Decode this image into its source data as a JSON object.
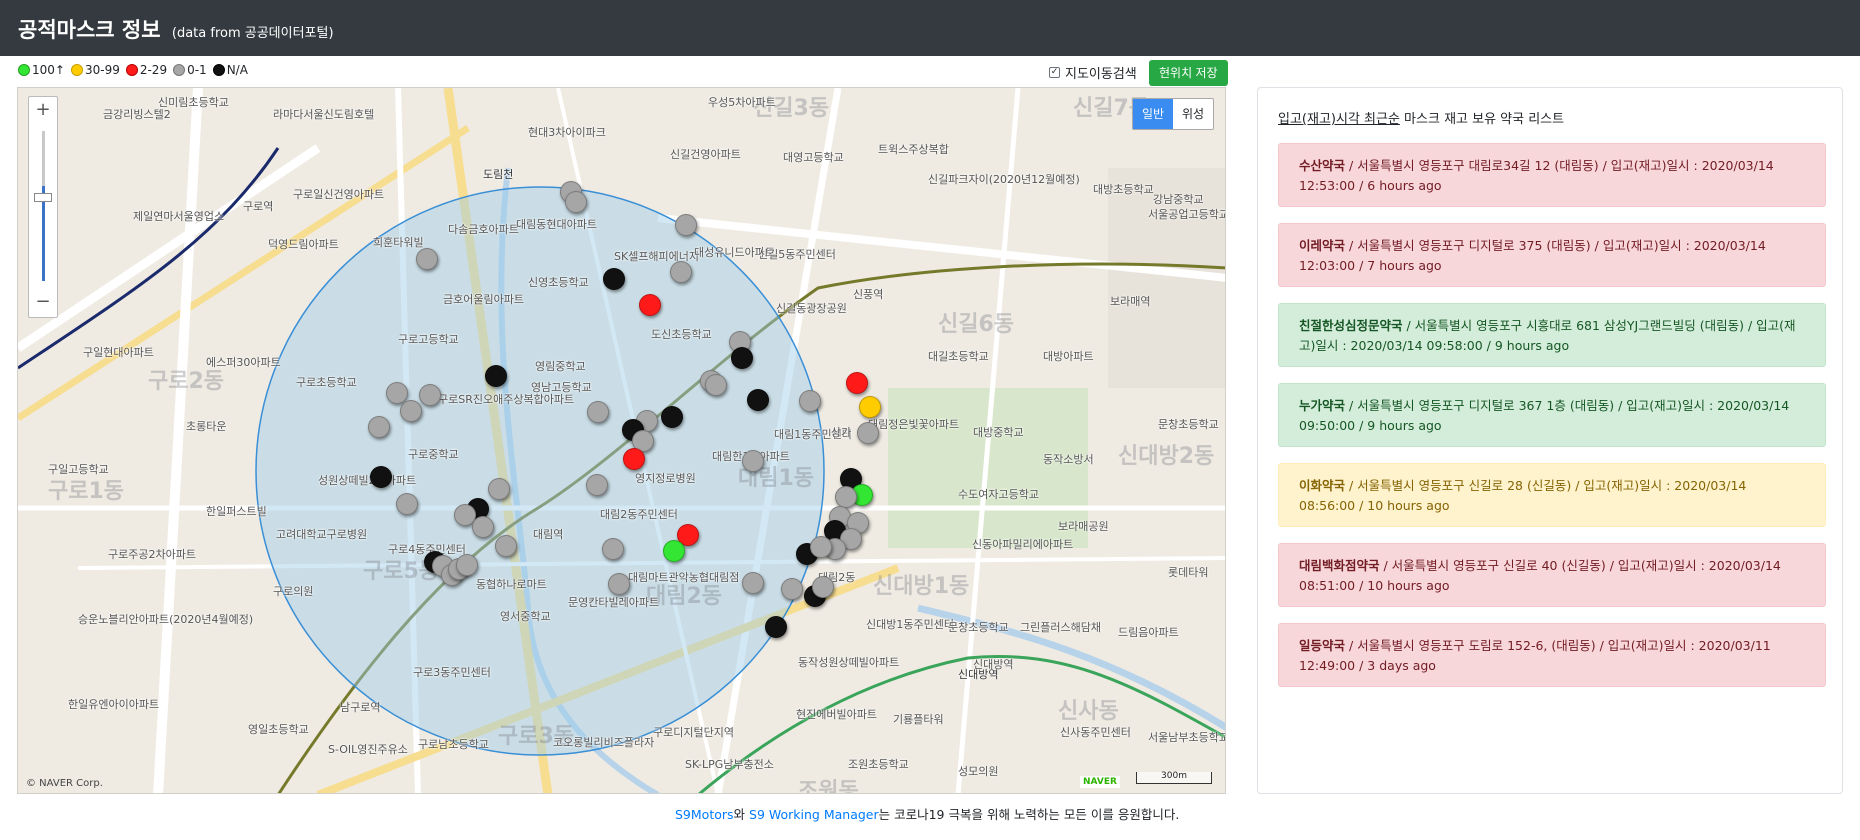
{
  "header": {
    "title": "공적마스크 정보",
    "subtitle": "(data from 공공데이터포털)"
  },
  "legend": [
    {
      "label": "100↑",
      "color": "#33e633"
    },
    {
      "label": "30-99",
      "color": "#ffcc00"
    },
    {
      "label": "2-29",
      "color": "#ff1a1a"
    },
    {
      "label": "0-1",
      "color": "#a6a6a6"
    },
    {
      "label": "N/A",
      "color": "#111111"
    }
  ],
  "controls": {
    "move_search_label": "지도이동검색",
    "move_search_checked": true,
    "save_location_label": "현위치 저장"
  },
  "map": {
    "zoom_in": "+",
    "zoom_out": "−",
    "map_type": {
      "normal": "일반",
      "satellite": "위성",
      "selected": "일반"
    },
    "copyright": "© NAVER Corp.",
    "logo": "NAVER",
    "scale": "300m",
    "labels": [
      "신미림초등학교",
      "라마다서울신도림호텔",
      "금강리빙스텔2",
      "제일연마서울영업소",
      "구로일신건영아파트",
      "구로역",
      "덕영드림아파트",
      "희훈타워빌",
      "다솜금호아파트",
      "현대3차아이파크",
      "신길건영아파트",
      "우성5차아파트",
      "대영고등학교",
      "트윅스주상복합",
      "신길파크자이(2020년12월예정)",
      "대방초등학교",
      "강남중학교",
      "서울공업고등학교",
      "대림동현대아파트",
      "SK셀프해피에너지",
      "대성유니드아파트",
      "신길5동주민센터",
      "신영초등학교",
      "금호어울림아파트",
      "구로고등학교",
      "구일현대아파트",
      "에스퍼30아파트",
      "구로초등학교",
      "초롱타운",
      "구로SR진오애주상복합아파트",
      "영림중학교",
      "도신초등학교",
      "신길동광장공원",
      "신풍역",
      "보라매역",
      "대길초등학교",
      "대방아파트",
      "대방중학교",
      "동작소방서",
      "문창초등학교",
      "대림1동주민센터",
      "상가",
      "대림정은빛꽃아파트",
      "영남고등학교",
      "구로중학교",
      "구일고등학교",
      "성원상떼빌2차아파트",
      "한일퍼스트빌",
      "고려대학교구로병원",
      "구로의원",
      "구로주공2차아파트",
      "영지정로병원",
      "대림한1차아파트",
      "대림역",
      "대림2동주민센터",
      "수도여자고등학교",
      "보라매공원",
      "신동아파밀리에아파트",
      "롯데타워",
      "구로4동주민센터",
      "동협하나로마트",
      "영서중학교",
      "문영칸타빌레아파트",
      "대림마트관악농협대림점",
      "대림2동",
      "신대방1동주민센터",
      "문창초등학교",
      "그린플러스해담채",
      "드림음아파트",
      "승운노블리안아파트(2020년4월예정)",
      "한일유엔아이아파트",
      "영일초등학교",
      "구로3동주민센터",
      "남구로역",
      "구로남초등학교",
      "코오롱빌리비즈플라자",
      "구로디지털단지역",
      "동작성원상떼빌아파트",
      "현진에버빌아파트",
      "기룡플타워",
      "SK-LPG남부충전소",
      "S-OIL영진주유소",
      "조원초등학교",
      "성모의원",
      "신사동주민센터",
      "서울남부초등학교",
      "신대방역"
    ],
    "areas": [
      "신길3동",
      "신길7동",
      "신길6동",
      "구로2동",
      "구로1동",
      "대림1동",
      "신대방2동",
      "신대방1동",
      "대림2동",
      "구로5동",
      "신사동",
      "조원동",
      "구로3동",
      "도림천",
      "신대방역"
    ]
  },
  "panel": {
    "heading_underlined": "입고(재고)시각 최근순",
    "heading_rest": " 마스크 재고 보유 약국 리스트",
    "pharmacies": [
      {
        "name": "수산약국",
        "detail": " / 서울특별시 영등포구 대림로34길 12 (대림동) / 입고(재고)일시 : 2020/03/14 12:53:00 / 6 hours ago",
        "status": "red"
      },
      {
        "name": "이레약국",
        "detail": " / 서울특별시 영등포구 디지털로 375 (대림동) / 입고(재고)일시 : 2020/03/14 12:03:00 / 7 hours ago",
        "status": "red"
      },
      {
        "name": "친절한성심정문약국",
        "detail": " / 서울특별시 영등포구 시흥대로 681 삼성YJ그랜드빌딩 (대림동) / 입고(재고)일시 : 2020/03/14 09:58:00 / 9 hours ago",
        "status": "green"
      },
      {
        "name": "누가약국",
        "detail": " / 서울특별시 영등포구 디지털로 367 1층 (대림동) / 입고(재고)일시 : 2020/03/14 09:50:00 / 9 hours ago",
        "status": "green"
      },
      {
        "name": "이화약국",
        "detail": " / 서울특별시 영등포구 신길로 28 (신길동) / 입고(재고)일시 : 2020/03/14 08:56:00 / 10 hours ago",
        "status": "yellow"
      },
      {
        "name": "대림백화점약국",
        "detail": " / 서울특별시 영등포구 신길로 40 (신길동) / 입고(재고)일시 : 2020/03/14 08:51:00 / 10 hours ago",
        "status": "red"
      },
      {
        "name": "일등약국",
        "detail": " / 서울특별시 영등포구 도림로 152-6, (대림동) / 입고(재고)일시 : 2020/03/11 12:49:00 / 3 days ago",
        "status": "red"
      }
    ]
  },
  "footer": {
    "link1": "S9Motors",
    "mid1": "와 ",
    "link2": "S9 Working Manager",
    "rest": "는 코로나19 극복을 위해 노력하는 모든 이를 응원합니다."
  }
}
